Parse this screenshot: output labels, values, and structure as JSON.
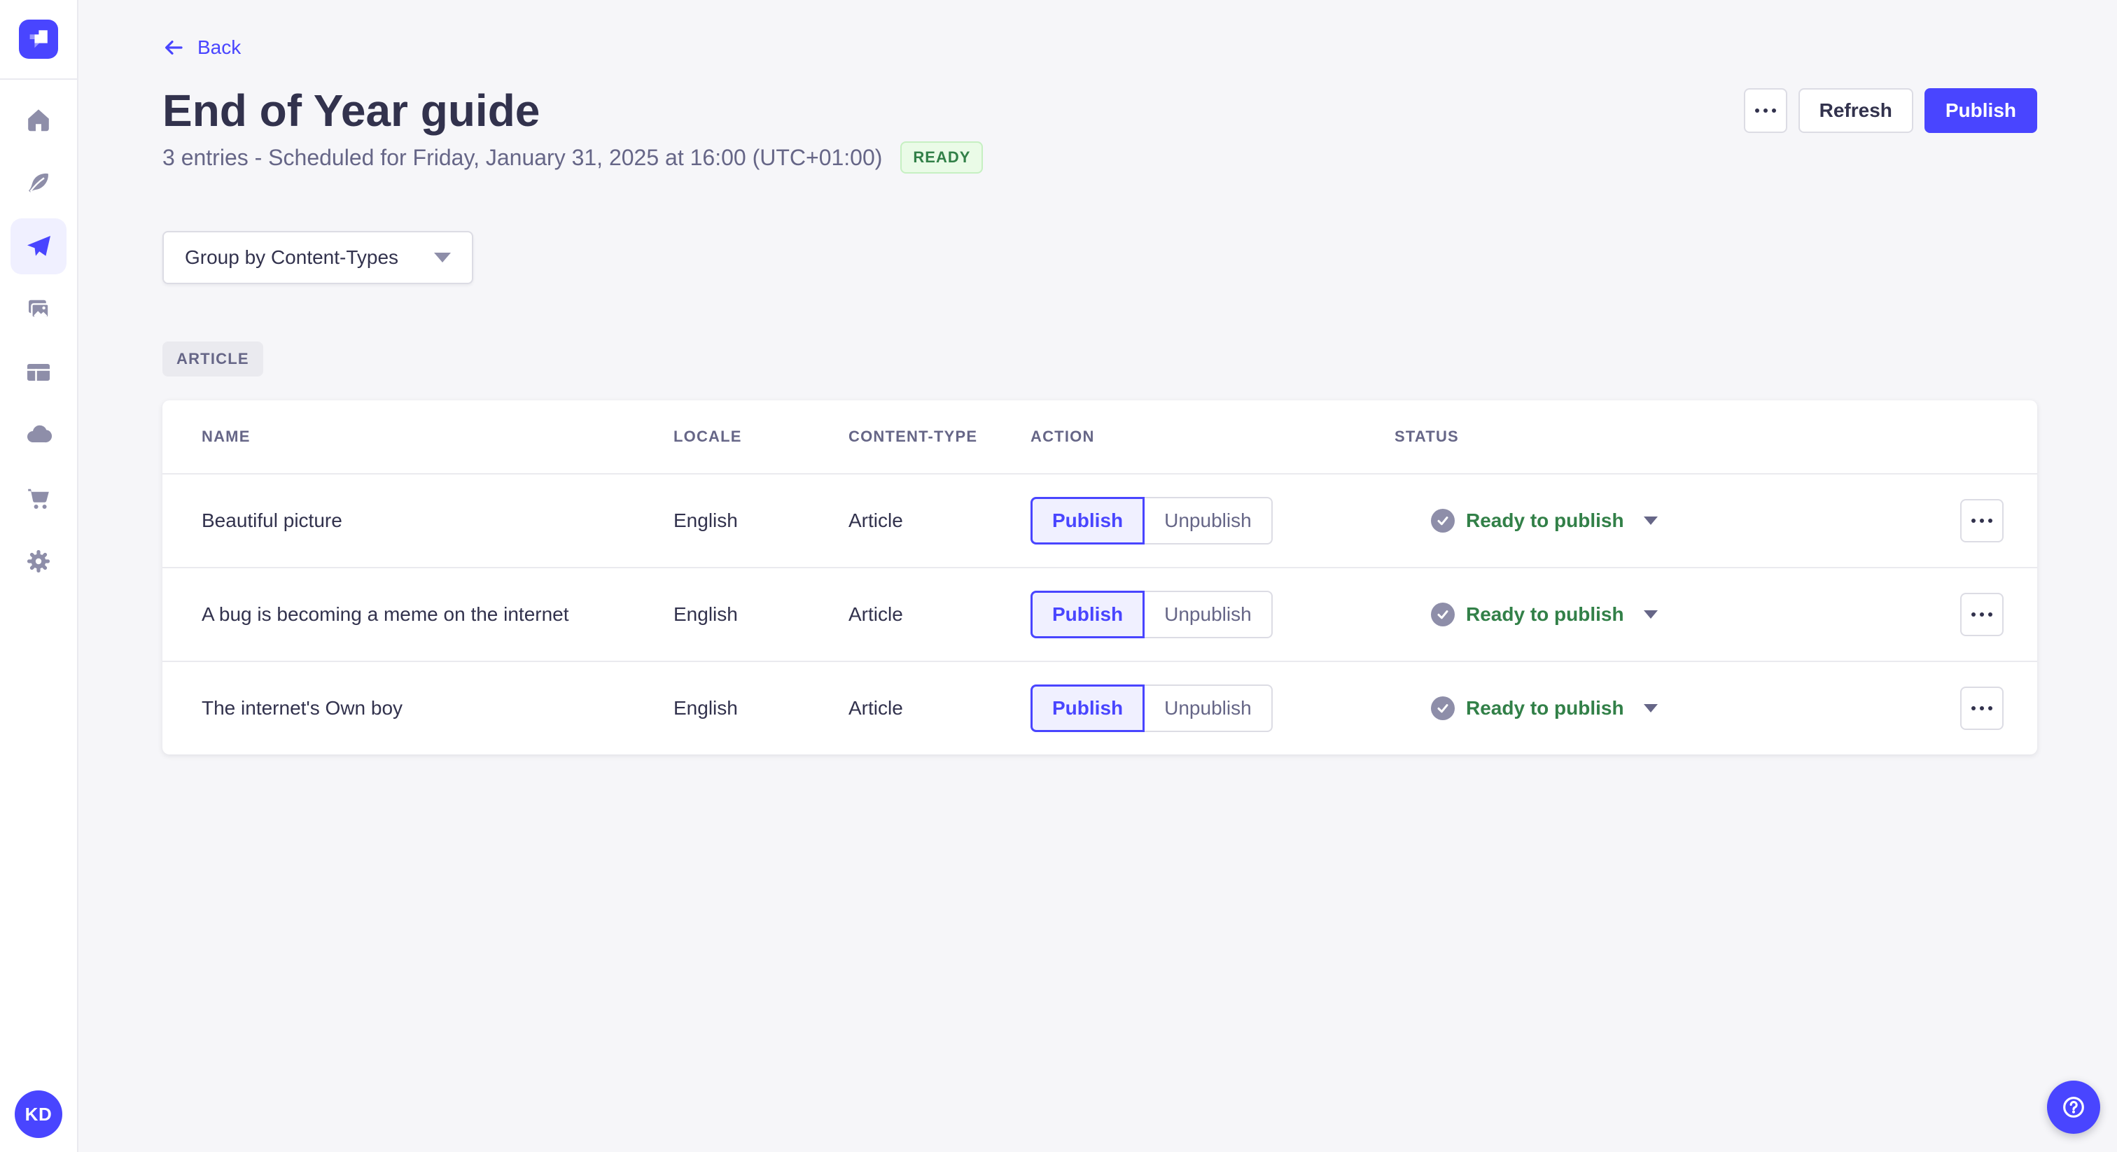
{
  "sidebar": {
    "avatar_initials": "KD",
    "items": [
      {
        "icon": "home-icon",
        "active": false
      },
      {
        "icon": "content-manager-icon",
        "active": false
      },
      {
        "icon": "releases-icon",
        "active": true
      },
      {
        "icon": "media-library-icon",
        "active": false
      },
      {
        "icon": "content-type-builder-icon",
        "active": false
      },
      {
        "icon": "cloud-icon",
        "active": false
      },
      {
        "icon": "marketplace-icon",
        "active": false
      },
      {
        "icon": "settings-icon",
        "active": false
      }
    ]
  },
  "header": {
    "back_label": "Back",
    "title": "End of Year guide",
    "subtitle": "3 entries - Scheduled for Friday, January 31, 2025 at 16:00 (UTC+01:00)",
    "status_badge": "READY",
    "refresh_label": "Refresh",
    "publish_label": "Publish"
  },
  "toolbar": {
    "group_by_label": "Group by Content-Types"
  },
  "group": {
    "tag": "ARTICLE"
  },
  "table": {
    "columns": [
      "NAME",
      "LOCALE",
      "CONTENT-TYPE",
      "ACTION",
      "STATUS"
    ],
    "rows": [
      {
        "name": "Beautiful picture",
        "locale": "English",
        "content_type": "Article",
        "publish_label": "Publish",
        "unpublish_label": "Unpublish",
        "status": "Ready to publish"
      },
      {
        "name": "A bug is becoming a meme on the internet",
        "locale": "English",
        "content_type": "Article",
        "publish_label": "Publish",
        "unpublish_label": "Unpublish",
        "status": "Ready to publish"
      },
      {
        "name": "The internet's Own boy",
        "locale": "English",
        "content_type": "Article",
        "publish_label": "Publish",
        "unpublish_label": "Unpublish",
        "status": "Ready to publish"
      }
    ]
  },
  "colors": {
    "primary": "#4945ff",
    "primary_bg": "#f0f0ff",
    "success_text": "#328048",
    "success_bg": "#eafbe7",
    "success_border": "#c6f0c2",
    "page_bg": "#f6f6f9",
    "card_border": "#eaeaef",
    "control_border": "#dcdce4",
    "text_dark": "#32324d",
    "text_muted": "#666687",
    "icon_gray": "#8e8ea9"
  }
}
